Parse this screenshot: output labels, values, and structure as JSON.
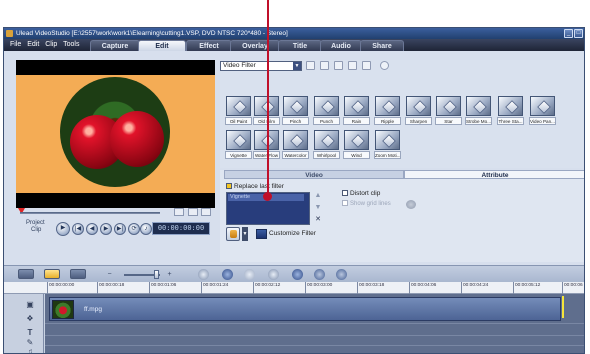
{
  "window": {
    "title": "Ulead VideoStudio [E:\\2557\\work\\work1\\Elearning\\cutting1.VSP, DVD NTSC 720*480 - Stereo]",
    "controls": [
      "_",
      "□",
      "×"
    ]
  },
  "menu": [
    "File",
    "Edit",
    "Clip",
    "Tools"
  ],
  "steps": [
    {
      "label": "Capture",
      "active": false
    },
    {
      "label": "Edit",
      "active": true
    },
    {
      "label": "Effect",
      "active": false
    },
    {
      "label": "Overlay",
      "active": false
    },
    {
      "label": "Title",
      "active": false
    },
    {
      "label": "Audio",
      "active": false
    },
    {
      "label": "Share",
      "active": false
    }
  ],
  "player": {
    "project_label": "Project",
    "clip_label": "Clip",
    "timecode": "00:00:00:00"
  },
  "library": {
    "category": "Video Filter",
    "row1": [
      "Oil Paint",
      "Old Film",
      "Pinch",
      "Punch",
      "Rain",
      "Ripple",
      "Sharpen",
      "Star",
      "Strobe Mo...",
      "Three Sta...",
      "Video Pan..."
    ],
    "row2": [
      "Vignette",
      "Water Flow",
      "Watercolor",
      "Whirlpool",
      "Wind",
      "Zoom Moti..."
    ]
  },
  "options": {
    "tabs": [
      {
        "label": "Video",
        "active": false
      },
      {
        "label": "Attribute",
        "active": true
      }
    ],
    "replace_last_filter": "Replace last filter",
    "applied_filters": [
      "Vignette"
    ],
    "distort_clip": "Distort clip",
    "show_grid_lines": "Show grid lines",
    "customize_filter": "Customize Filter"
  },
  "ruler": [
    "00:00:00:00",
    "00:00:00:18",
    "00:00:01:06",
    "00:00:01:24",
    "00:00:02:12",
    "00:00:03:00",
    "00:00:03:18",
    "00:00:04:06",
    "00:00:04:24",
    "00:00:05:12",
    "00:00:06"
  ],
  "timeline": {
    "clip_name": "ff.mpg",
    "track_icons": [
      "video-track-icon",
      "overlay-track-icon",
      "title-track-icon",
      "voice-track-icon",
      "music-track-icon"
    ]
  },
  "colors": {
    "accent_annotation": "#c0102a",
    "preview_bg": "#f4ac55",
    "timeline_bg": "#5f6e8d"
  }
}
